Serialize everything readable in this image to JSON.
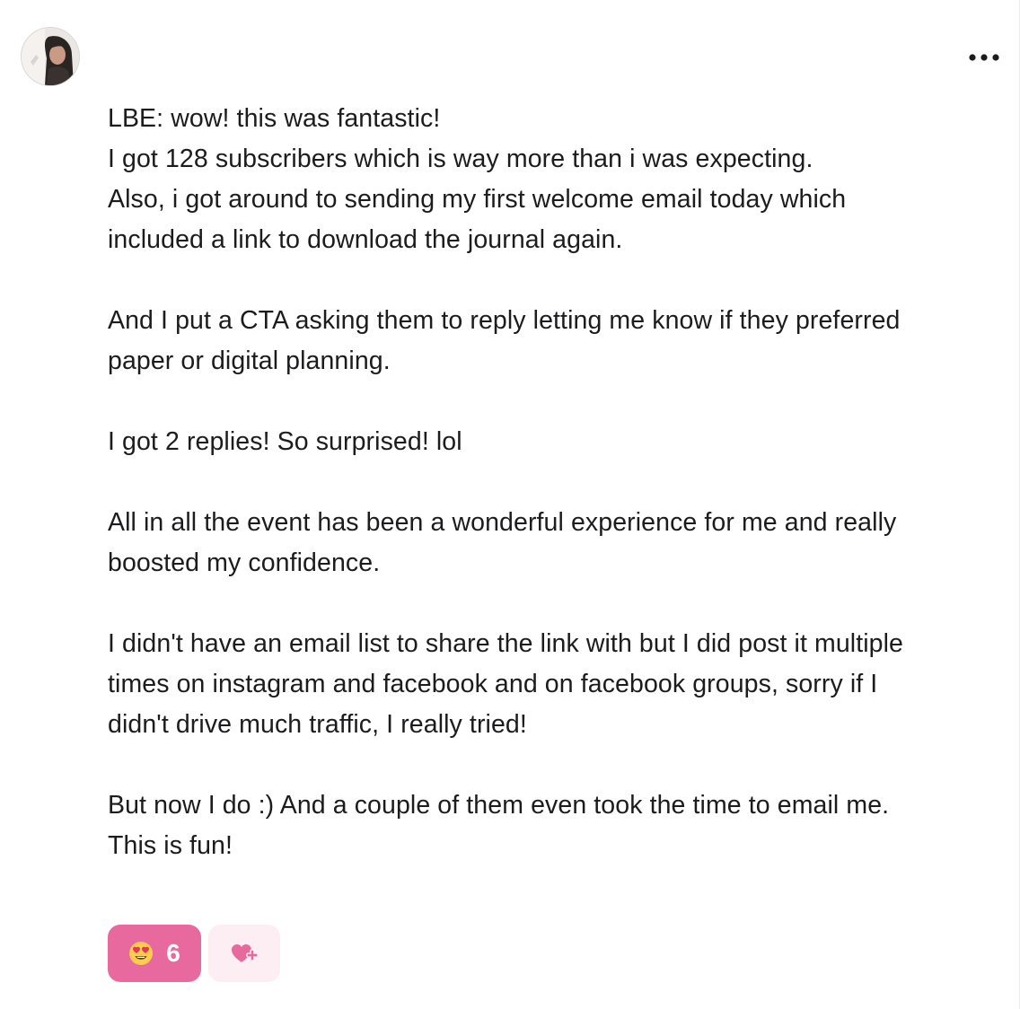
{
  "post": {
    "paragraphs": [
      [
        "LBE: wow! this was fantastic!",
        "I got 128 subscribers which is way more than i was expecting.",
        "Also, i got around to sending my first welcome email today which",
        "included a link to download the journal again."
      ],
      [
        "And I put a CTA asking them to reply letting me know if they preferred",
        "paper or digital planning."
      ],
      [
        "I got 2 replies! So surprised! lol"
      ],
      [
        "All in all the event has been a wonderful experience for me and really",
        "boosted my confidence."
      ],
      [
        "I didn't have an email list to share the link with but I did post it multiple",
        "times on instagram and facebook and on facebook groups, sorry if I",
        "didn't drive much traffic, I really tried!"
      ],
      [
        "But now I do :) And a couple of them even took the time to email me.",
        "This is fun!"
      ]
    ]
  },
  "reactions": {
    "emoji": "😍",
    "count": "6",
    "icon": "heart-eyes-emoji",
    "add_icon": "heart-plus-icon"
  },
  "menu": {
    "icon": "more-horizontal-icon"
  },
  "colors": {
    "accent": "#e7699d",
    "accent_light": "#fdeef4",
    "text": "#1c1c1e"
  }
}
